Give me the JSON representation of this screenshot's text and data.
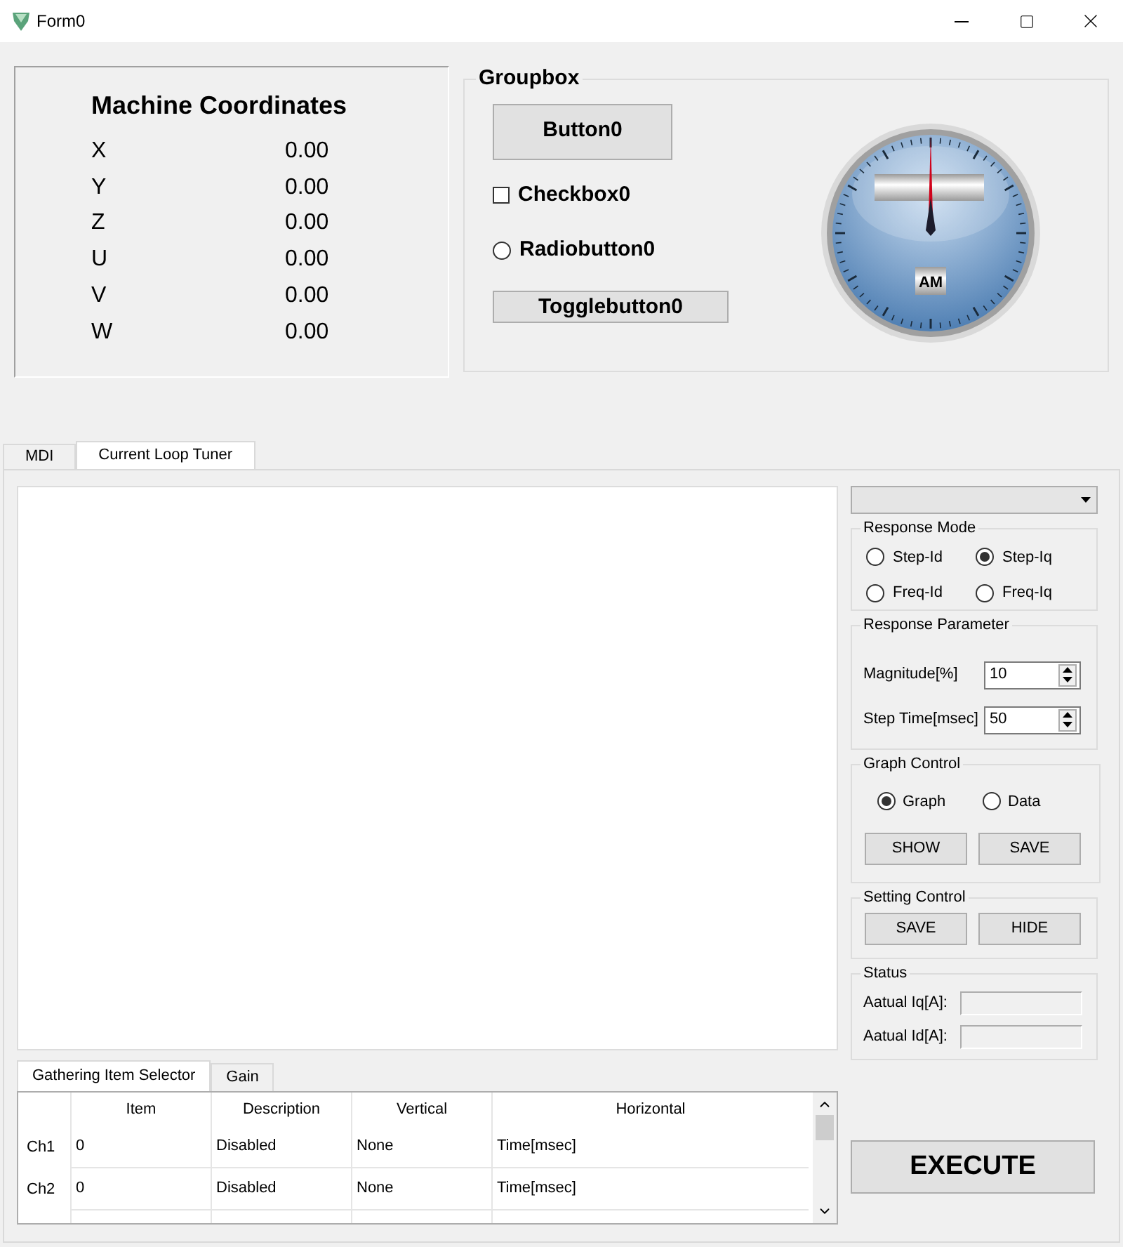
{
  "window": {
    "title": "Form0"
  },
  "coordinates": {
    "title": "Machine Coordinates",
    "axes": [
      {
        "label": "X",
        "value": "0.00"
      },
      {
        "label": "Y",
        "value": "0.00"
      },
      {
        "label": "Z",
        "value": "0.00"
      },
      {
        "label": "U",
        "value": "0.00"
      },
      {
        "label": "V",
        "value": "0.00"
      },
      {
        "label": "W",
        "value": "0.00"
      }
    ]
  },
  "groupbox": {
    "title": "Groupbox",
    "button": "Button0",
    "checkbox": {
      "label": "Checkbox0",
      "checked": false
    },
    "radio": {
      "label": "Radiobutton0",
      "selected": false
    },
    "toggle": {
      "label": "Togglebutton0",
      "on": false
    },
    "gauge": {
      "label": "AM"
    }
  },
  "tabs": [
    {
      "label": "MDI",
      "selected": false
    },
    {
      "label": "Current Loop Tuner",
      "selected": true
    }
  ],
  "response_mode": {
    "title": "Response Mode",
    "options": [
      {
        "label": "Step-Id",
        "selected": false
      },
      {
        "label": "Step-Iq",
        "selected": true
      },
      {
        "label": "Freq-Id",
        "selected": false
      },
      {
        "label": "Freq-Iq",
        "selected": false
      }
    ]
  },
  "response_parameter": {
    "title": "Response Parameter",
    "fields": [
      {
        "label": "Magnitude[%]",
        "value": "10"
      },
      {
        "label": "Step Time[msec]",
        "value": "50"
      }
    ]
  },
  "graph_control": {
    "title": "Graph Control",
    "options": [
      {
        "label": "Graph",
        "selected": true
      },
      {
        "label": "Data",
        "selected": false
      }
    ],
    "buttons": [
      "SHOW",
      "SAVE"
    ]
  },
  "setting_control": {
    "title": "Setting Control",
    "buttons": [
      "SAVE",
      "HIDE"
    ]
  },
  "status": {
    "title": "Status",
    "fields": [
      {
        "label": "Aatual Iq[A]:"
      },
      {
        "label": "Aatual Id[A]:"
      }
    ]
  },
  "execute": "EXECUTE",
  "bottom_tabs": [
    {
      "label": "Gathering Item Selector",
      "selected": true
    },
    {
      "label": "Gain",
      "selected": false
    }
  ],
  "table": {
    "columns": [
      "Item",
      "Description",
      "Vertical",
      "Horizontal"
    ],
    "rows": [
      {
        "header": "Ch1",
        "cells": [
          "0",
          "Disabled",
          "None",
          "Time[msec]"
        ]
      },
      {
        "header": "Ch2",
        "cells": [
          "0",
          "Disabled",
          "None",
          "Time[msec]"
        ]
      }
    ]
  }
}
